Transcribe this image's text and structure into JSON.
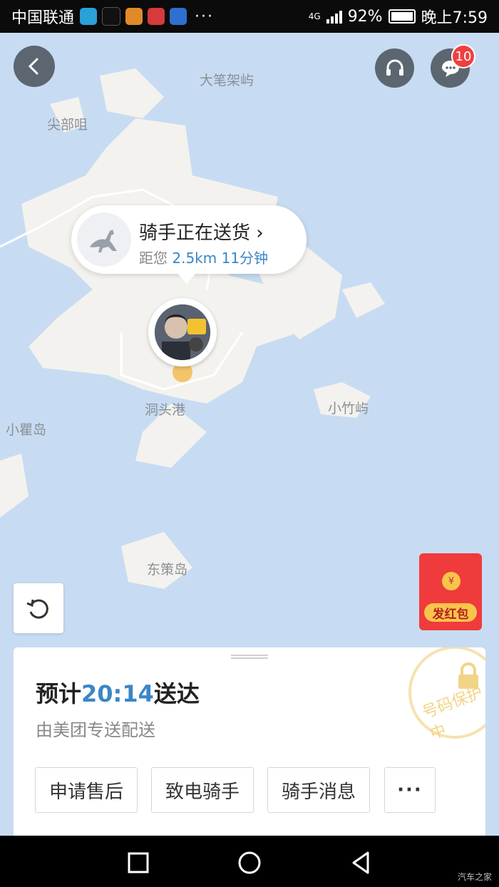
{
  "status_bar": {
    "carrier": "中国联通",
    "network": "4G",
    "battery": "92%",
    "time": "晚上7:59",
    "more": "···"
  },
  "map": {
    "places": [
      "大笔架屿",
      "尖部咀",
      "洞头港",
      "小瞿岛",
      "小竹屿",
      "东策岛"
    ]
  },
  "header": {
    "back_icon": "chevron-left-icon",
    "service_icon": "headset-icon",
    "message_icon": "chat-bubble-icon",
    "message_count": "10"
  },
  "rider_bubble": {
    "status": "骑手正在送货",
    "distance_prefix": "距您",
    "distance": "2.5km",
    "eta_minutes": "11分钟"
  },
  "red_packet": {
    "coin": "¥",
    "label": "发红包"
  },
  "order_card": {
    "eta_prefix": "预计",
    "eta_time": "20:14",
    "eta_suffix": "送达",
    "delivered_by": "由美团专送配送",
    "stamp": "号码保护中",
    "buttons": [
      "申请售后",
      "致电骑手",
      "骑手消息",
      "···"
    ]
  },
  "watermark": "汽车之家",
  "colors": {
    "accent_blue": "#3b86c6",
    "red_packet": "#ef3b3b",
    "map_water": "#c7dcf2",
    "map_land": "#f3f1ec"
  }
}
